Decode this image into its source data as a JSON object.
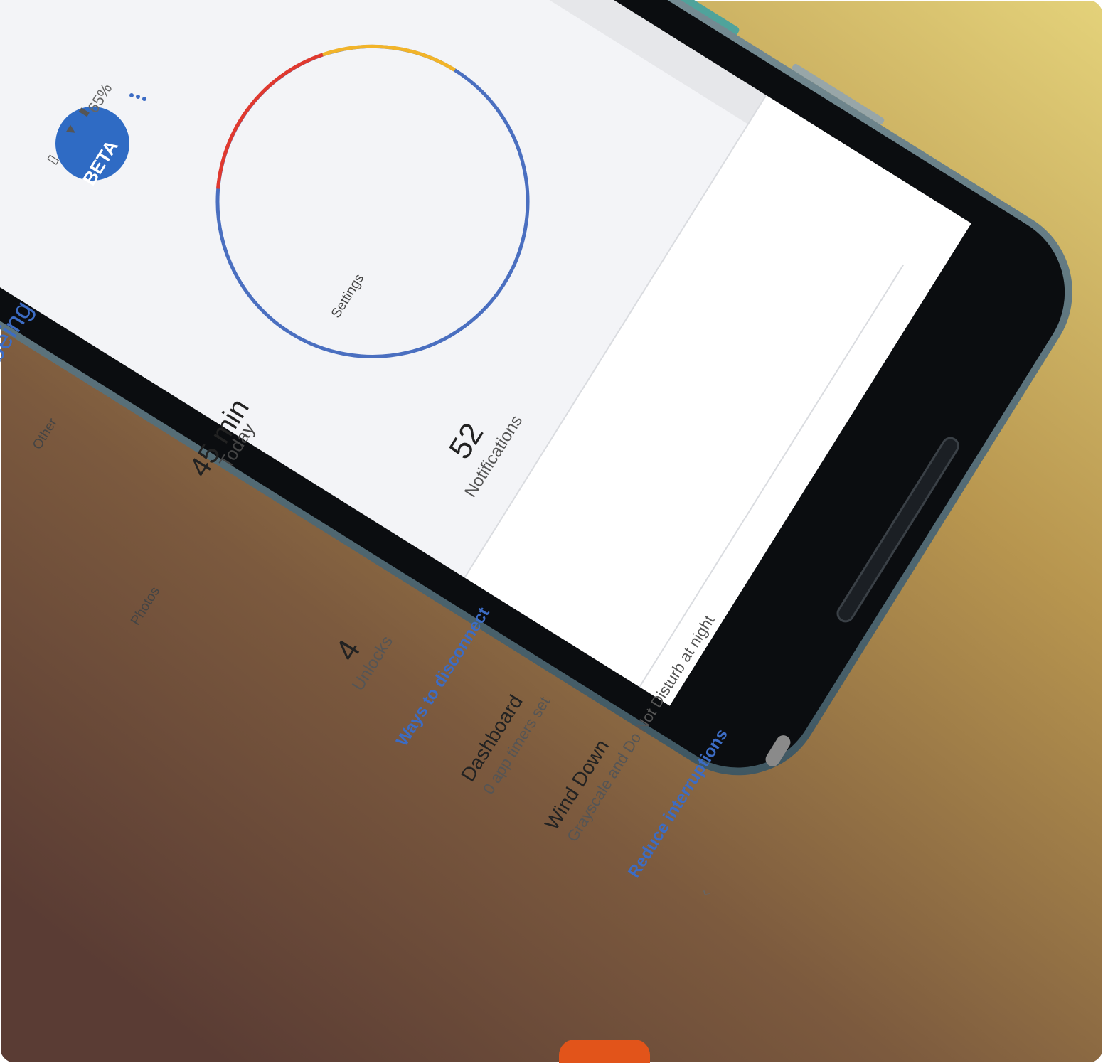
{
  "status_bar": {
    "battery": "65%",
    "icons": [
      "vibrate-icon",
      "wifi-icon",
      "battery-icon"
    ]
  },
  "app": {
    "title_partial": "being",
    "badge": "BETA",
    "menu_icon": "more-dots-icon"
  },
  "usage": {
    "time_value": "45 min",
    "time_label": "Today",
    "ring_labels": [
      "Settings",
      "Other",
      "Photos"
    ],
    "ring_colors": {
      "blue": "#4a6fc0",
      "yellow": "#f2b429",
      "red": "#e0392f"
    }
  },
  "stats": {
    "unlocks_value": "4",
    "unlocks_label": "Unlocks",
    "notifications_value": "52",
    "notifications_label": "Notifications"
  },
  "section": {
    "heading": "Ways to disconnect",
    "items": [
      {
        "title": "Dashboard",
        "subtitle": "0 app timers set"
      },
      {
        "title": "Wind Down",
        "subtitle": "Grayscale and Do Not Disturb at night"
      }
    ],
    "link": "Reduce interruptions"
  },
  "nav": {
    "back_icon": "back-chevron-icon"
  },
  "colors": {
    "accent_blue": "#3c6cc4",
    "badge_blue": "#2f6bc4",
    "orange_tab": "#e2541a"
  }
}
